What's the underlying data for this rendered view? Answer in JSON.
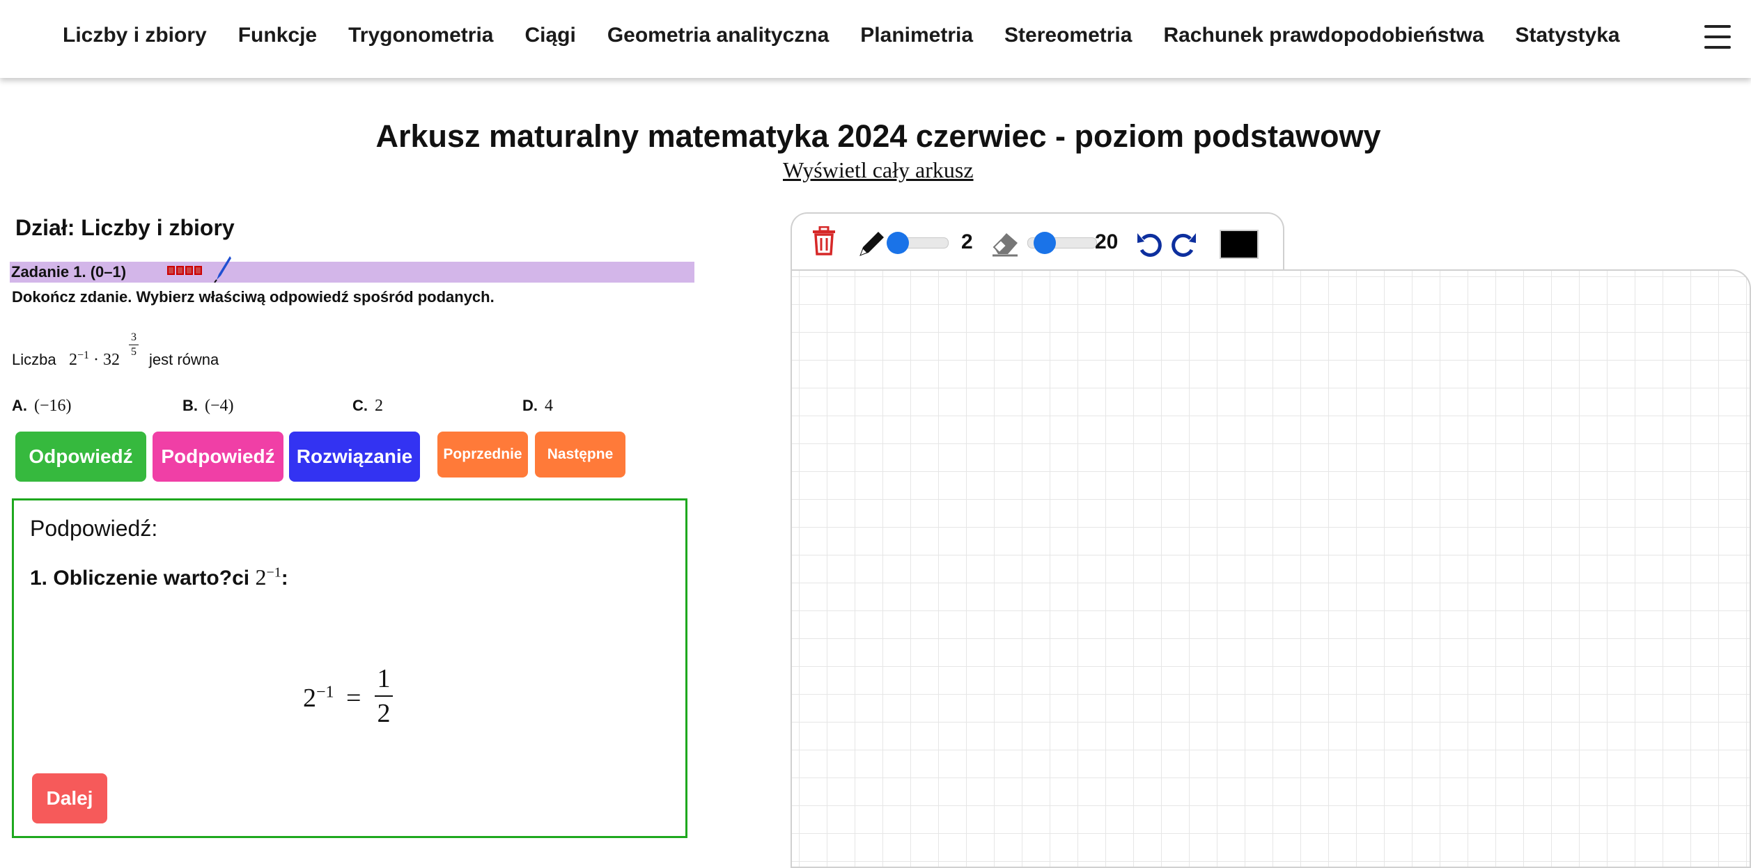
{
  "nav": {
    "items": [
      "Liczby i zbiory",
      "Funkcje",
      "Trygonometria",
      "Ciągi",
      "Geometria analityczna",
      "Planimetria",
      "Stereometria",
      "Rachunek prawdopodobieństwa",
      "Statystyka"
    ],
    "menu_icon": "hamburger-menu-icon"
  },
  "page": {
    "title": "Arkusz maturalny matematyka 2024 czerwiec - poziom podstawowy",
    "sheet_link": "Wyświetl cały arkusz"
  },
  "task": {
    "section": "Dział: Liczby i zbiory",
    "label": "Zadanie 1. (0–1)",
    "instruction": "Dokończ zdanie. Wybierz właściwą odpowiedź spośród podanych.",
    "problem_prefix": "Liczba",
    "problem_base": "2",
    "problem_exp": "−1",
    "problem_mid": "· 32",
    "problem_frac_num": "3",
    "problem_frac_den": "5",
    "problem_suffix": "jest równa",
    "answers": [
      {
        "letter": "A.",
        "value": "(−16)"
      },
      {
        "letter": "B.",
        "value": "(−4)"
      },
      {
        "letter": "C.",
        "value": "2"
      },
      {
        "letter": "D.",
        "value": "4"
      }
    ]
  },
  "buttons": {
    "answer": "Odpowiedź",
    "hint": "Podpowiedź",
    "solution": "Rozwiązanie",
    "previous": "Poprzednie",
    "next": "Następne",
    "continue": "Dalej"
  },
  "hint": {
    "heading": "Podpowiedź:",
    "step_text": "1. Obliczenie warto?ci",
    "step_base": "2",
    "step_exp": "−1",
    "step_colon": ":",
    "formula_base": "2",
    "formula_exp": "−1",
    "formula_eq": "=",
    "formula_num": "1",
    "formula_den": "2"
  },
  "toolbar": {
    "pen_size": "2",
    "pen_level": 0.0,
    "eraser_size": "20",
    "eraser_level": 0.2,
    "color": "#000000",
    "icons": [
      "trash-icon",
      "pencil-icon",
      "eraser-icon",
      "undo-icon",
      "redo-icon"
    ]
  },
  "colors": {
    "answer_button": "#36b93e",
    "hint_button": "#f03fa6",
    "solution_button": "#3333f2",
    "nav_buttons": "#ff7a39",
    "continue_button": "#f65a5a",
    "task_bar": "#d3b6e9",
    "hint_border": "#1ea81e",
    "trash": "#d62828",
    "slider_knob": "#1a73e8"
  }
}
